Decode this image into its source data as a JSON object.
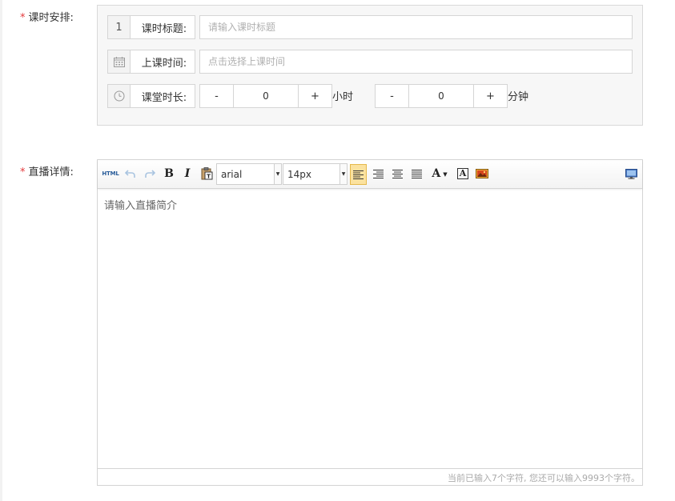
{
  "schedule": {
    "label": "课时安排:",
    "required_mark": "*",
    "lesson_number": "1",
    "title_label": "课时标题:",
    "title_placeholder": "请输入课时标题",
    "time_label": "上课时间:",
    "time_placeholder": "点击选择上课时间",
    "duration_label": "课堂时长:",
    "hours": {
      "decrement": "-",
      "value": "0",
      "increment": "+",
      "unit": "小时"
    },
    "minutes": {
      "decrement": "-",
      "value": "0",
      "increment": "+",
      "unit": "分钟"
    },
    "icons": {
      "time": "calendar-icon",
      "duration": "clock-icon"
    }
  },
  "live_details": {
    "label": "直播详情:",
    "required_mark": "*",
    "toolbar": {
      "html_label": "HTML",
      "bold": "B",
      "italic": "I",
      "font_family": "arial",
      "font_size": "14px",
      "font_color": "A",
      "highlight": "A",
      "icons": [
        "html-source-icon",
        "undo-icon",
        "redo-icon",
        "bold-icon",
        "italic-icon",
        "paste-text-icon",
        "align-left-icon",
        "align-right-icon",
        "align-center-icon",
        "align-justify-icon",
        "font-color-icon",
        "background-color-icon",
        "insert-image-icon",
        "fullscreen-icon"
      ]
    },
    "placeholder": "请输入直播简介",
    "counter": "当前已输入7个字符, 您还可以输入9993个字符。"
  },
  "colors": {
    "required": "#e4393c",
    "active_button": "#fbe29f",
    "panel_bg": "#f7f7f7"
  }
}
